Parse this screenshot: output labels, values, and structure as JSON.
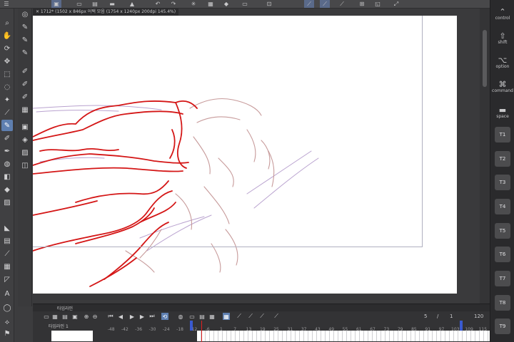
{
  "app": {
    "document_tab": "✕ 1712* (1502 x 846px 어택 모음 (1754 x 1240px 200dpi 145.4%)"
  },
  "colors": {
    "stroke_primary": "#d41616",
    "stroke_secondary": "#c79a9a",
    "stroke_tertiary": "#b9a2cf",
    "accent": "#5e7fb0",
    "current_color": "#e21b1b"
  },
  "topbar": {
    "icons": [
      "menu-icon",
      "document-icon",
      "new-icon",
      "open-icon",
      "save-icon",
      "undo-icon",
      "redo-icon",
      "settings-icon",
      "transform-icon",
      "fill-icon",
      "eraser-icon",
      "select-icon",
      "lasso-icon",
      "pen-icon",
      "ruler-icon",
      "snap-icon"
    ]
  },
  "tools": {
    "items": [
      "zoom-icon",
      "hand-icon",
      "rotate-icon",
      "move-icon",
      "select-icon",
      "lasso-icon",
      "magic-wand-icon",
      "eyedropper-icon",
      "pen-icon",
      "pencil-icon",
      "brush-icon",
      "airbrush-icon",
      "eraser-icon",
      "fill-icon",
      "gradient-icon",
      "shape-icon",
      "frame-icon",
      "text-icon",
      "balloon-icon",
      "line-icon",
      "correction-icon"
    ],
    "sub_items": [
      "subtool-icon",
      "subtool-icon",
      "subtool-icon",
      "subtool-icon",
      "subtool-icon",
      "subtool-icon",
      "subtool-icon",
      "subtool-icon",
      "subtool-icon",
      "subtool-icon",
      "subtool-icon",
      "subtool-icon"
    ]
  },
  "keys": {
    "modifiers": [
      {
        "glyph": "⌃",
        "label": "control"
      },
      {
        "glyph": "⇧",
        "label": "shift"
      },
      {
        "glyph": "⌥",
        "label": "option"
      },
      {
        "glyph": "⌘",
        "label": "command"
      },
      {
        "glyph": "▬",
        "label": "space"
      }
    ],
    "shortcuts": [
      "T1",
      "T2",
      "T3",
      "T4",
      "T5",
      "T6",
      "T7",
      "T8",
      "T9"
    ]
  },
  "timeline": {
    "tab_label": "타임라인",
    "track_name": "타임라인 1",
    "frame_current": "5",
    "frame_sep": "/",
    "frame_start": "1",
    "frame_end": "120",
    "ruler_ticks": [
      "-48",
      "-42",
      "-36",
      "-30",
      "-24",
      "-18",
      "-12",
      "-6",
      "1",
      "7",
      "13",
      "19",
      "25",
      "31",
      "37",
      "43",
      "49",
      "55",
      "61",
      "67",
      "73",
      "79",
      "85",
      "91",
      "97",
      "103",
      "109",
      "115"
    ]
  }
}
